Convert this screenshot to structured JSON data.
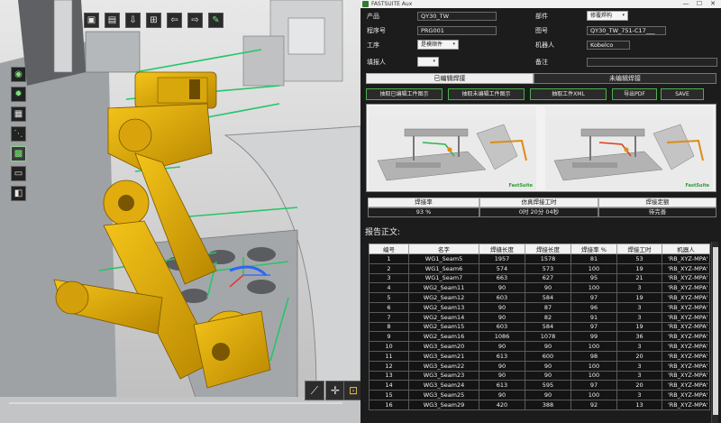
{
  "window": {
    "title": "FASTSUITE Aux",
    "controls": [
      "—",
      "☐",
      "✕"
    ]
  },
  "form": {
    "product_label": "产品",
    "product_value": "QY30_TW",
    "part_label": "部件",
    "part_value": "修覆焊构",
    "program_label": "程序号",
    "program_value": "PRG001",
    "drawing_label": "图号",
    "drawing_value": "QY30_TW_751-C17___",
    "process_label": "工序",
    "process_value": "是模顺件",
    "robot_label": "机器人",
    "robot_value": "Kobelco",
    "reporter_label": "填报人",
    "reporter_value": "",
    "remark_label": "备注",
    "remark_value": ""
  },
  "tabs": {
    "edited": "已编辑焊接",
    "unedited": "未编辑焊接"
  },
  "actions": {
    "capture_edited": "抽取已编辑工件图示",
    "capture_unedited": "抽取未编辑工件图示",
    "capture_xml": "抽取工件XML",
    "export_pdf": "导出PDF",
    "save": "SAVE"
  },
  "stats": {
    "rate_header": "焊接率",
    "rate_value": "93 %",
    "time_header": "仿真焊接工时",
    "time_value": "0时 20分 04秒",
    "quota_header": "焊接定额",
    "quota_value": "待完善"
  },
  "report": {
    "title": "报告正文:",
    "columns": [
      "编号",
      "名字",
      "焊缝长度",
      "焊接长度",
      "焊接率 %",
      "焊接工时",
      "机器人"
    ],
    "rows": [
      [
        "1",
        "WG1_Seam5",
        "1957",
        "1578",
        "81",
        "53",
        "'RB_XYZ-MPA'"
      ],
      [
        "2",
        "WG1_Seam6",
        "574",
        "573",
        "100",
        "19",
        "'RB_XYZ-MPA'"
      ],
      [
        "3",
        "WG1_Seam7",
        "663",
        "627",
        "95",
        "21",
        "'RB_XYZ-MPA'"
      ],
      [
        "4",
        "WG2_Seam11",
        "90",
        "90",
        "100",
        "3",
        "'RB_XYZ-MPA'"
      ],
      [
        "5",
        "WG2_Seam12",
        "603",
        "584",
        "97",
        "19",
        "'RB_XYZ-MPA'"
      ],
      [
        "6",
        "WG2_Seam13",
        "90",
        "87",
        "96",
        "3",
        "'RB_XYZ-MPA'"
      ],
      [
        "7",
        "WG2_Seam14",
        "90",
        "82",
        "91",
        "3",
        "'RB_XYZ-MPA'"
      ],
      [
        "8",
        "WG2_Seam15",
        "603",
        "584",
        "97",
        "19",
        "'RB_XYZ-MPA'"
      ],
      [
        "9",
        "WG2_Seam16",
        "1086",
        "1078",
        "99",
        "36",
        "'RB_XYZ-MPA'"
      ],
      [
        "10",
        "WG3_Seam20",
        "90",
        "90",
        "100",
        "3",
        "'RB_XYZ-MPA'"
      ],
      [
        "11",
        "WG3_Seam21",
        "613",
        "600",
        "98",
        "20",
        "'RB_XYZ-MPA'"
      ],
      [
        "12",
        "WG3_Seam22",
        "90",
        "90",
        "100",
        "3",
        "'RB_XYZ-MPA'"
      ],
      [
        "13",
        "WG3_Seam23",
        "90",
        "90",
        "100",
        "3",
        "'RB_XYZ-MPA'"
      ],
      [
        "14",
        "WG3_Seam24",
        "613",
        "595",
        "97",
        "20",
        "'RB_XYZ-MPA'"
      ],
      [
        "15",
        "WG3_Seam25",
        "90",
        "90",
        "100",
        "3",
        "'RB_XYZ-MPA'"
      ],
      [
        "16",
        "WG3_Seam29",
        "420",
        "388",
        "92",
        "13",
        "'RB_XYZ-MPA'"
      ]
    ]
  },
  "viewport": {
    "toolbar_icons": [
      "folder-open-icon",
      "save-icon",
      "export-icon",
      "tree-icon",
      "arrow-left-icon",
      "arrow-right-icon",
      "pen-icon"
    ],
    "side_icons": [
      "compass-icon",
      "settings-icon",
      "image-icon",
      "link-icon",
      "grid-icon",
      "document-icon",
      "save-floppy-icon"
    ],
    "bottom_icons": [
      "measure-icon",
      "target-icon",
      "fit-view-icon"
    ],
    "colors": {
      "robot": "#e8b40c",
      "robot_dark": "#a37a00",
      "wire": "#26c56a",
      "accent_green": "#4caf50"
    }
  },
  "previews": {
    "brand": "FastSuite"
  }
}
